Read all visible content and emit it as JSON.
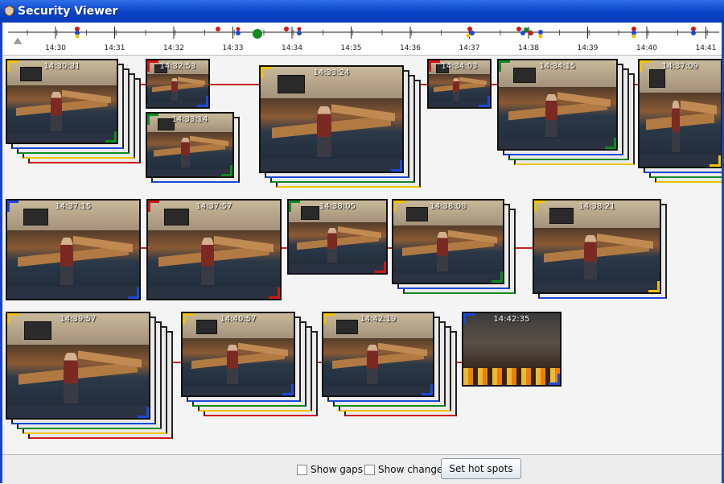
{
  "window": {
    "title": "Security Viewer"
  },
  "timeline": {
    "labels": [
      "14:30",
      "14:31",
      "14:32",
      "14:33",
      "14:34",
      "14:35",
      "14:36",
      "14:37",
      "14:38",
      "14:39",
      "14:40",
      "14:41"
    ]
  },
  "clips": [
    {
      "time": "14:30:31"
    },
    {
      "time": "14:32:53"
    },
    {
      "time": "14:33:14"
    },
    {
      "time": "14:33:24"
    },
    {
      "time": "14:34:03"
    },
    {
      "time": "14:34:15"
    },
    {
      "time": "14:37:09"
    },
    {
      "time": "14:37:15"
    },
    {
      "time": "14:37:57"
    },
    {
      "time": "14:38:05"
    },
    {
      "time": "14:38:08"
    },
    {
      "time": "14:38:21"
    },
    {
      "time": "14:39:57"
    },
    {
      "time": "14:40:57"
    },
    {
      "time": "14:42:19"
    },
    {
      "time": "14:42:35"
    }
  ],
  "bottom": {
    "show_gaps": "Show gaps",
    "show_change": "Show change",
    "set_hot_spots": "Set hot spots"
  },
  "colors": {
    "red": "#d01818",
    "green": "#118a22",
    "blue": "#1a4ad8",
    "yellow": "#f2c300",
    "title": "#0a43c8"
  }
}
